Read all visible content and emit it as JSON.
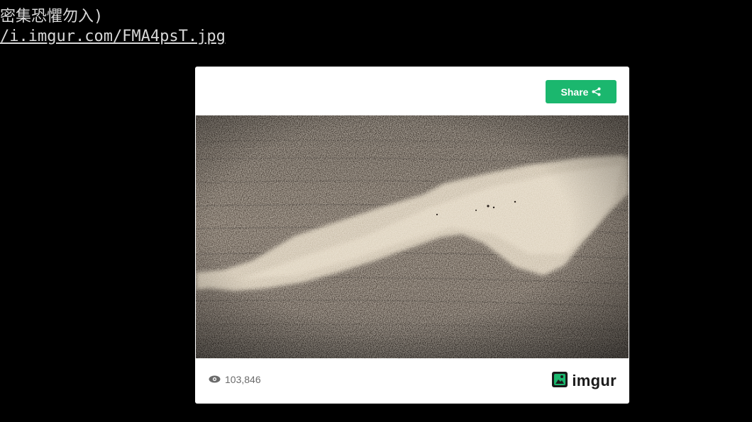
{
  "post": {
    "line1": "密集恐懼勿入)",
    "link_text": "/i.imgur.com/FMA4psT.jpg"
  },
  "embed": {
    "share_label": "Share",
    "share_icon": "share-icon",
    "image_alt": "sand-like granules spread on a dark wooden surface",
    "views_icon": "eye-icon",
    "views_count": "103,846",
    "brand": "imgur",
    "brand_icon": "imgur-logo-icon",
    "colors": {
      "share_button": "#1bb76e",
      "brand_icon": "#1bb76e",
      "page_background": "#000000",
      "card_background": "#ffffff"
    }
  }
}
